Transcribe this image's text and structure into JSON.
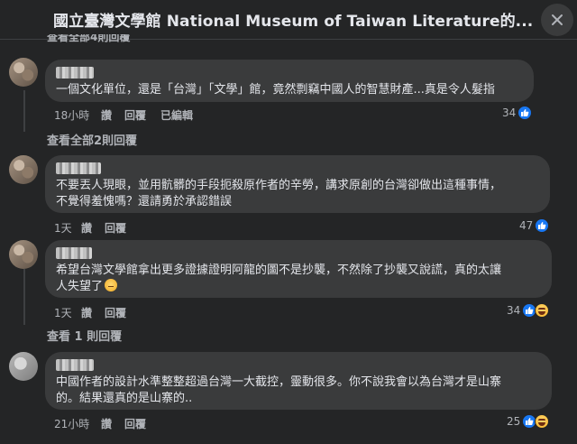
{
  "header": {
    "title": "國立臺灣文學館 National Museum of Taiwan Literature的..."
  },
  "partial_top": {
    "label": "查看全部4則回覆"
  },
  "comments": [
    {
      "lines": [
        "一個文化單位，還是「台灣」「文學」館，竟然剽竊中國人的智慧財產...真是令人髮指"
      ],
      "time": "18小時",
      "like_label": "讚",
      "reply_label": "回覆",
      "edited_label": "已編輯",
      "reaction_count": "34",
      "reactions": [
        "like"
      ],
      "view_replies": "查看全部2則回覆"
    },
    {
      "lines": [
        "不要丟人現眼，並用骯髒的手段扼殺原作者的辛勞，講求原創的台灣卻做出這種事情，",
        "不覺得羞愧嗎？還請勇於承認錯誤"
      ],
      "time": "1天",
      "like_label": "讚",
      "reply_label": "回覆",
      "reaction_count": "47",
      "reactions": [
        "like"
      ]
    },
    {
      "lines": [
        "希望台灣文學館拿出更多證據證明阿龍的圖不是抄襲，不然除了抄襲又說謊，真的太讓",
        "人失望了"
      ],
      "time": "1天",
      "like_label": "讚",
      "reply_label": "回覆",
      "reaction_count": "34",
      "reactions": [
        "like",
        "haha"
      ],
      "view_replies": "查看 1 則回覆"
    },
    {
      "lines": [
        "中國作者的設計水準整整超過台灣一大截控，靈動很多。你不說我會以為台灣才是山寨",
        "的。結果還真的是山寨的.."
      ],
      "time": "21小時",
      "like_label": "讚",
      "reply_label": "回覆",
      "reaction_count": "25",
      "reactions": [
        "like",
        "haha"
      ]
    }
  ],
  "icons": {
    "close": "close-icon",
    "like": "like-reaction-icon",
    "haha": "haha-reaction-icon",
    "disappointed": "disappointed-emoji-icon"
  },
  "colors": {
    "background": "#242526",
    "bubble": "#3a3b3c",
    "text": "#e4e6eb",
    "secondary_text": "#b0b3b8",
    "like_blue": "#1877f2"
  }
}
